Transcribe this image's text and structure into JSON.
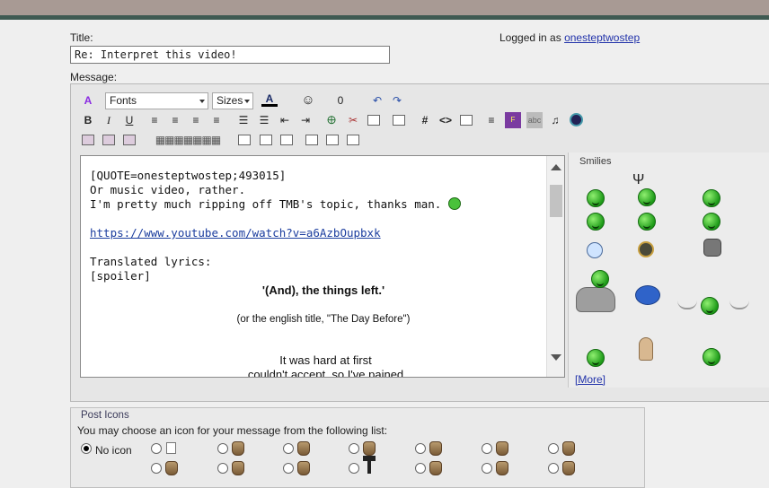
{
  "form": {
    "title_label": "Title:",
    "title_value": "Re: Interpret this video!",
    "message_label": "Message:",
    "logged_in_prefix": "Logged in as",
    "username": "onesteptwostep"
  },
  "toolbar": {
    "font_select": "Fonts",
    "size_select": "Sizes",
    "bold": "B",
    "italic": "I",
    "underline": "U",
    "hash": "#",
    "code": "<>"
  },
  "editor": {
    "lines": [
      "[QUOTE=onesteptwostep;493015]",
      "Or music video, rather.",
      "I'm pretty much ripping off TMB's topic, thanks man.",
      "",
      "https://www.youtube.com/watch?v=a6AzbOupbxk",
      "",
      "Translated lyrics:",
      "[spoiler]"
    ],
    "song_title": "'(And), the things left.'",
    "english_title": "(or the english title, \"The Day Before\")",
    "lyric_1": "It was hard at first",
    "lyric_2": "couldn't accept, so I've pained"
  },
  "smilies": {
    "title": "Smilies",
    "more": "[More]"
  },
  "post_icons": {
    "title": "Post Icons",
    "description": "You may choose an icon for your message from the following list:",
    "no_icon": "No icon"
  },
  "colors": {
    "link": "#2233aa",
    "top_bar": "#a89a94",
    "top_stripe": "#3f5a52",
    "smiley_green": "#1d9a18"
  }
}
